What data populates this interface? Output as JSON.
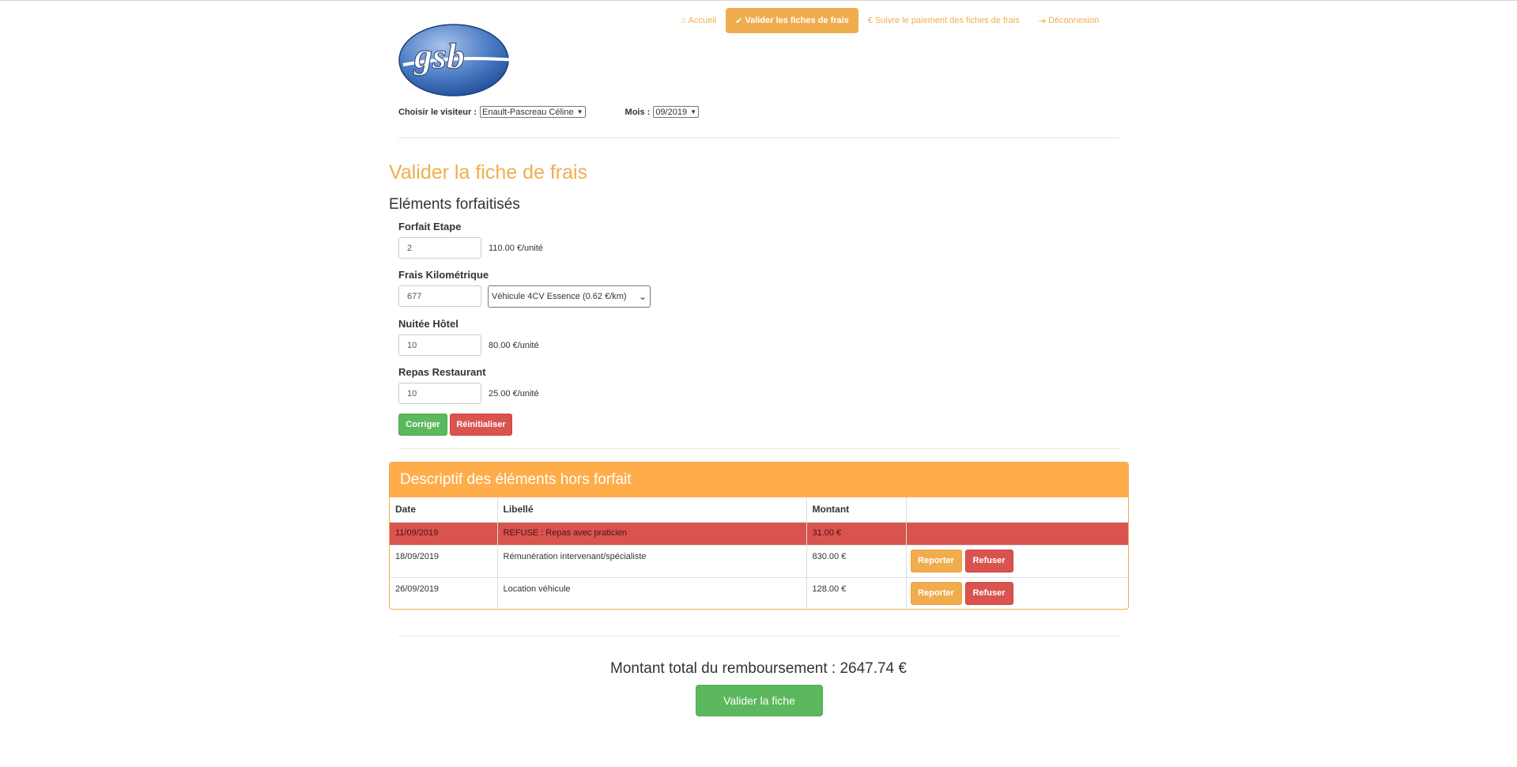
{
  "nav": {
    "items": [
      {
        "label": "Accueil",
        "icon": "home-icon",
        "glyph": "⌂"
      },
      {
        "label": "Valider les fiches de frais",
        "icon": "check-icon",
        "glyph": "✔"
      },
      {
        "label": "Suivre le paiement des fiches de frais",
        "icon": "euro-icon",
        "glyph": "€"
      },
      {
        "label": "Déconnexion",
        "icon": "logout-icon",
        "glyph": "⇥"
      }
    ],
    "active_index": 1
  },
  "logo": {
    "text": "gsb"
  },
  "selectors": {
    "visitor_label": "Choisir le visiteur :",
    "visitor_value": "Enault-Pascreau Céline",
    "month_label": "Mois :",
    "month_value": "09/2019"
  },
  "page": {
    "title": "Valider la fiche de frais",
    "subtitle": "Eléments forfaitisés"
  },
  "forfait": {
    "etape": {
      "label": "Forfait Etape",
      "value": "2",
      "unit": "110.00 €/unité"
    },
    "km": {
      "label": "Frais Kilométrique",
      "value": "677",
      "vehicle": "Véhicule 4CV Essence (0.62 €/km)"
    },
    "nuitee": {
      "label": "Nuitée Hôtel",
      "value": "10",
      "unit": "80.00 €/unité"
    },
    "repas": {
      "label": "Repas Restaurant",
      "value": "10",
      "unit": "25.00 €/unité"
    },
    "correct_label": "Corriger",
    "reset_label": "Réinitialiser"
  },
  "hors_forfait": {
    "heading": "Descriptif des éléments hors forfait",
    "columns": [
      "Date",
      "Libellé",
      "Montant",
      ""
    ],
    "rows": [
      {
        "date": "11/09/2019",
        "libelle": "REFUSE : Repas avec praticien",
        "montant": "31.00 €"
      },
      {
        "date": "18/09/2019",
        "libelle": "Rémunération intervenant/spécialiste",
        "montant": "830.00 €"
      },
      {
        "date": "26/09/2019",
        "libelle": "Location véhicule",
        "montant": "128.00 €"
      }
    ],
    "report_label": "Reporter",
    "refuse_label": "Refuser"
  },
  "footer": {
    "total": "Montant total du remboursement : 2647.74 €",
    "validate_label": "Valider la fiche"
  },
  "colors": {
    "accent": "#f0ad4e",
    "success": "#5cb85c",
    "danger": "#d9534f"
  }
}
